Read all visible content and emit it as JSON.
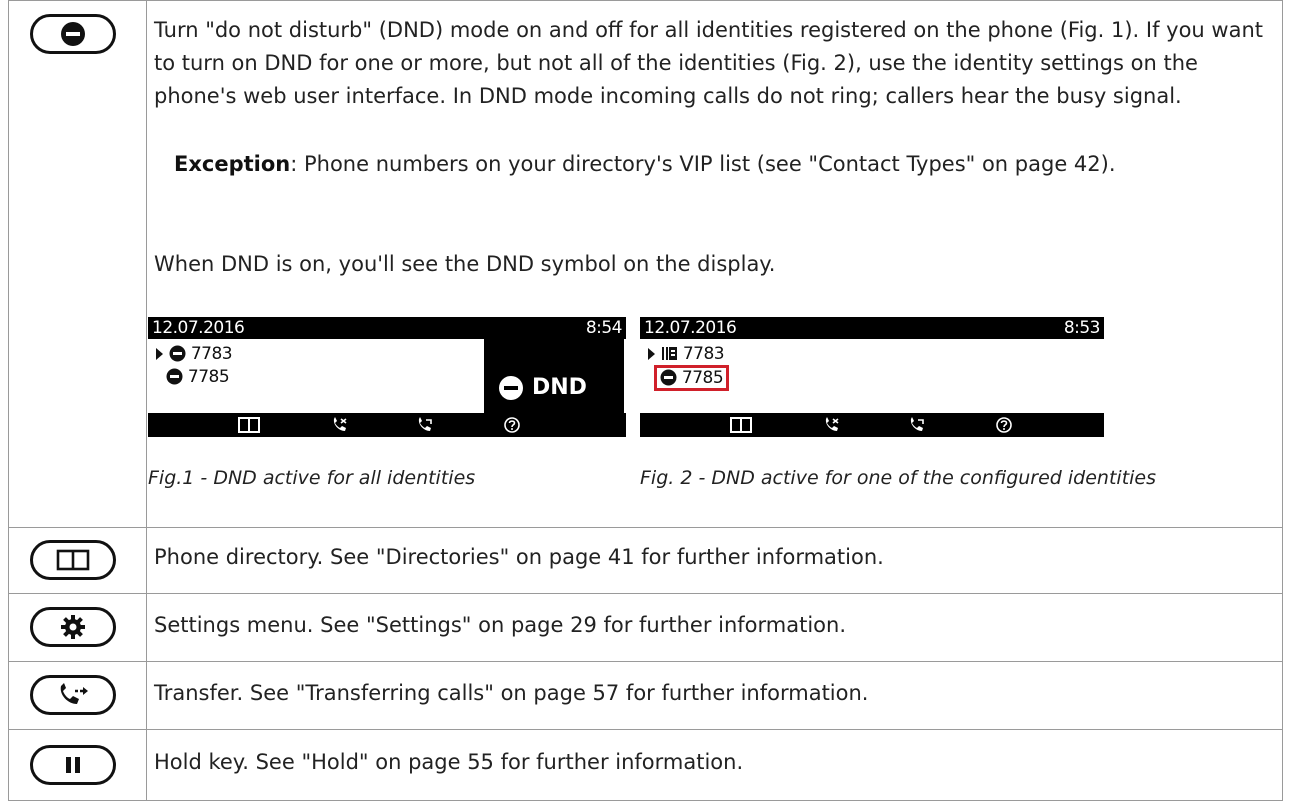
{
  "rows": {
    "dnd": {
      "key_icon": "dnd-minus-icon",
      "description": "Turn \"do not disturb\" (DND) mode on and off for all identities registered on the phone (Fig. 1).  If you want to turn on DND for one or more, but not all of the identities (Fig. 2), use the identity settings on the phone's web user interface.  In DND mode incoming calls do not ring; callers hear the busy signal.",
      "exception_label": "Exception",
      "exception_text": ":  Phone numbers on your directory's VIP list (see \"Contact Types\" on page 42).",
      "symbol_note": "When DND is on, you'll see the DND symbol on the display."
    },
    "directory": {
      "key_icon": "book-icon",
      "text": "Phone directory.  See \"Directories\" on page 41 for further information."
    },
    "settings": {
      "key_icon": "gear-icon",
      "text": "Settings menu.  See \"Settings\" on page 29 for further information."
    },
    "transfer": {
      "key_icon": "transfer-icon",
      "text": "Transfer.  See \"Transferring calls\" on page 57 for further information."
    },
    "hold": {
      "key_icon": "pause-icon",
      "text": "Hold key.  See \"Hold\" on page 55 for further information."
    }
  },
  "fig1": {
    "date": "12.07.2016",
    "time": "8:54",
    "identities": [
      "7783",
      "7785"
    ],
    "dnd_label": "DND",
    "caption": "Fig.1 - DND active for all identities"
  },
  "fig2": {
    "date": "12.07.2016",
    "time": "8:53",
    "identities": [
      "7783",
      "7785"
    ],
    "caption": "Fig. 2 - DND active for one of the configured identities",
    "highlight_color": "#d0202a"
  }
}
